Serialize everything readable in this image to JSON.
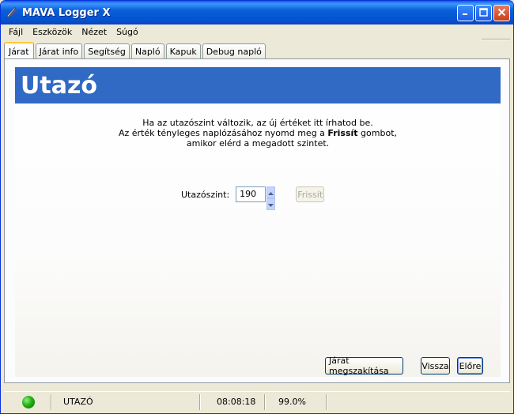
{
  "window": {
    "title": "MAVA Logger X"
  },
  "menu": {
    "items": [
      "Fájl",
      "Eszközök",
      "Nézet",
      "Súgó"
    ]
  },
  "tabs": [
    "Járat",
    "Járat info",
    "Segítség",
    "Napló",
    "Kapuk",
    "Debug napló"
  ],
  "panel": {
    "heading": "Utazó",
    "line1": "Ha az utazószint változik, az új értéket itt írhatod be.",
    "line2_before": "Az érték tényleges naplózásához nyomd meg a ",
    "line2_bold": "Frissít",
    "line2_after": " gombot,",
    "line3": "amikor elérd a megadott szintet.",
    "field_label": "Utazószint:",
    "field_value": "190",
    "refresh_label": "Frissít"
  },
  "buttons": {
    "abort": "Járat megszakítása",
    "back": "Vissza",
    "next": "Előre"
  },
  "status": {
    "phase": "UTAZÓ",
    "time": "08:08:18",
    "percent": "99.0%"
  },
  "colors": {
    "banner": "#316ac5",
    "status_led": "#22b014"
  },
  "icons": {
    "app": "plane-logo-icon",
    "minimize": "minimize-icon",
    "maximize": "maximize-icon",
    "close": "close-icon",
    "spin_up": "spin-up-icon",
    "spin_down": "spin-down-icon",
    "status": "status-led-icon"
  }
}
